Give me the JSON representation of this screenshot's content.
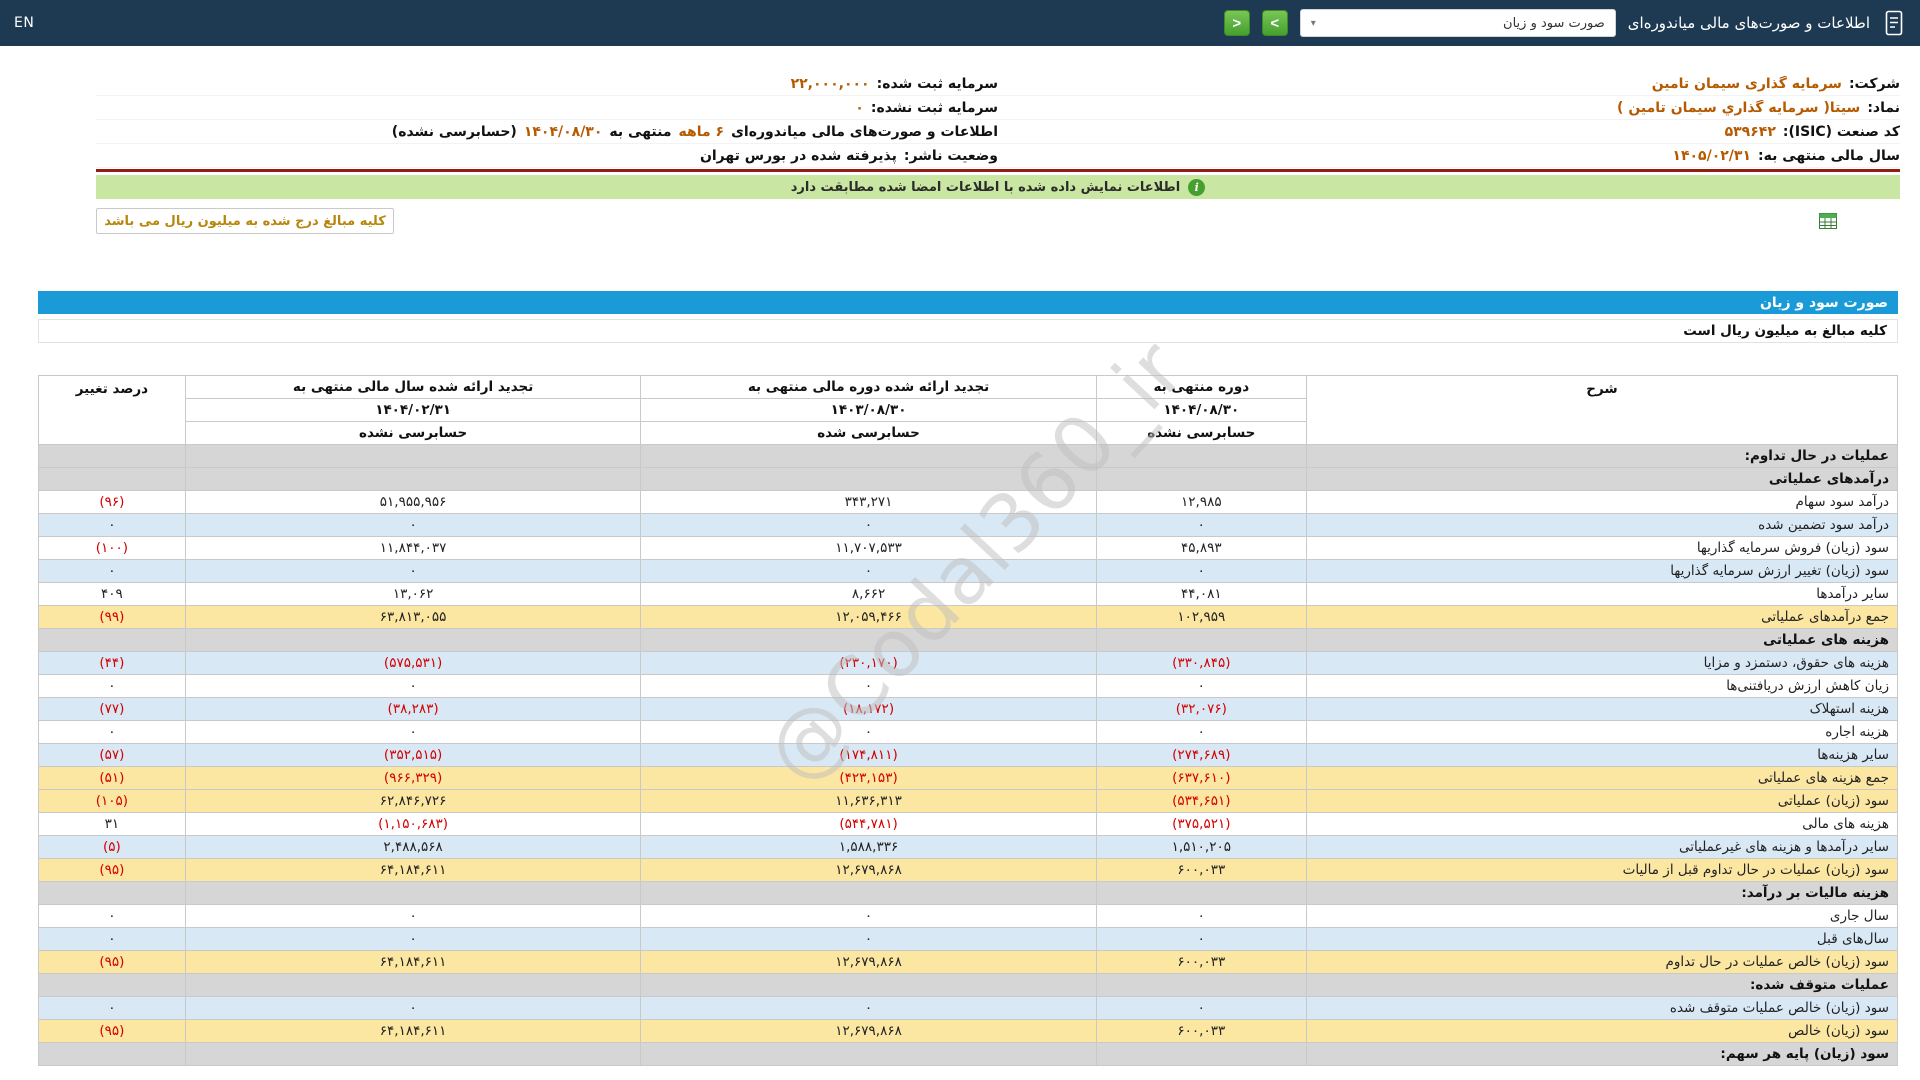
{
  "navbar": {
    "title": "اطلاعات و صورت‌های مالی میاندوره‌ای",
    "statement_select_value": "صورت سود و زیان",
    "select_caret": "▾",
    "next_button": ">",
    "prev_button": "<",
    "language": "EN"
  },
  "company_info": {
    "right_rows": [
      {
        "label": "شرکت:",
        "value": "سرمایه گذاری سیمان تامین"
      },
      {
        "label": "نماد:",
        "value": "سیتا( سرمایه گذاري سیمان تامین )"
      },
      {
        "label": "کد صنعت (ISIC):",
        "value": "۵۳۹۶۴۲"
      },
      {
        "label": "سال مالی منتهی به:",
        "value": "۱۴۰۵/۰۲/۳۱"
      }
    ],
    "left_rows": [
      {
        "label": "سرمایه ثبت شده:",
        "value": "۲۲,۰۰۰,۰۰۰",
        "value_style": "accent"
      },
      {
        "label": "سرمایه ثبت نشده:",
        "value": "۰",
        "value_style": "accent"
      },
      {
        "segments": [
          {
            "text": "اطلاعات و صورت‌های مالی میاندوره‌ای ",
            "style": "strong"
          },
          {
            "text": "۶ ماهه",
            "style": "accent"
          },
          {
            "text": " منتهی به ",
            "style": "strong"
          },
          {
            "text": "۱۴۰۴/۰۸/۳۰",
            "style": "accent"
          },
          {
            "text": "(حسابرسی نشده)",
            "style": "strong"
          }
        ]
      },
      {
        "label": "وضعیت ناشر:",
        "value": "پذیرفته شده در بورس تهران",
        "value_style": "strong"
      }
    ]
  },
  "signature_bar": {
    "text": "اطلاعات نمایش داده شده با اطلاعات امضا شده مطابقت دارد",
    "icon": "i"
  },
  "units_note": {
    "text": "کلیه مبالغ درج شده به میلیون ریال می باشد"
  },
  "statement": {
    "title": "صورت سود و زیان",
    "units_line": "کلیه مبالغ به میلیون ریال است",
    "watermark": "@Codal360_ir"
  },
  "table": {
    "headers": {
      "description": "شرح",
      "change": "درصد تغییر",
      "columns": [
        {
          "title": "دوره منتهی به",
          "date": "۱۴۰۴/۰۸/۳۰",
          "audit": "حسابرسی نشده"
        },
        {
          "title": "تجدید ارائه شده دوره مالی منتهی به",
          "date": "۱۴۰۳/۰۸/۳۰",
          "audit": "حسابرسی شده"
        },
        {
          "title": "تجدید ارائه شده سال مالی منتهی به",
          "date": "۱۴۰۴/۰۲/۳۱",
          "audit": "حسابرسی نشده"
        }
      ]
    },
    "rows": [
      {
        "type": "section",
        "label": "عملیات در حال تداوم:"
      },
      {
        "type": "section",
        "label": "درآمدهای عملیاتی"
      },
      {
        "type": "data",
        "shade": "white",
        "label": "درآمد سود سهام",
        "values": [
          "۱۲,۹۸۵",
          "۳۴۳,۲۷۱",
          "۵۱,۹۵۵,۹۵۶",
          "(۹۶)"
        ]
      },
      {
        "type": "data",
        "shade": "blue",
        "label": "درآمد سود تضمین شده",
        "values": [
          "۰",
          "۰",
          "۰",
          "۰"
        ]
      },
      {
        "type": "data",
        "shade": "white",
        "label": "سود (زیان) فروش سرمایه گذاریها",
        "values": [
          "۴۵,۸۹۳",
          "۱۱,۷۰۷,۵۳۳",
          "۱۱,۸۴۴,۰۳۷",
          "(۱۰۰)"
        ]
      },
      {
        "type": "data",
        "shade": "blue",
        "label": "سود (زیان) تغییر ارزش سرمایه گذاریها",
        "values": [
          "۰",
          "۰",
          "۰",
          "۰"
        ]
      },
      {
        "type": "data",
        "shade": "white",
        "label": "سایر درآمدها",
        "values": [
          "۴۴,۰۸۱",
          "۸,۶۶۲",
          "۱۳,۰۶۲",
          "۴۰۹"
        ]
      },
      {
        "type": "data",
        "shade": "yellow",
        "label": "جمع درآمدهای عملیاتی",
        "values": [
          "۱۰۲,۹۵۹",
          "۱۲,۰۵۹,۴۶۶",
          "۶۳,۸۱۳,۰۵۵",
          "(۹۹)"
        ]
      },
      {
        "type": "section",
        "label": "هزینه های عملیاتی"
      },
      {
        "type": "data",
        "shade": "blue",
        "label": "هزینه های حقوق، دستمزد و مزایا",
        "values": [
          "(۳۳۰,۸۴۵)",
          "(۲۳۰,۱۷۰)",
          "(۵۷۵,۵۳۱)",
          "(۴۴)"
        ]
      },
      {
        "type": "data",
        "shade": "white",
        "label": "زیان کاهش ارزش دریافتنی‌ها",
        "values": [
          "۰",
          "۰",
          "۰",
          "۰"
        ]
      },
      {
        "type": "data",
        "shade": "blue",
        "label": "هزینه استهلاک",
        "values": [
          "(۳۲,۰۷۶)",
          "(۱۸,۱۷۲)",
          "(۳۸,۲۸۳)",
          "(۷۷)"
        ]
      },
      {
        "type": "data",
        "shade": "white",
        "label": "هزینه اجاره",
        "values": [
          "۰",
          "۰",
          "۰",
          "۰"
        ]
      },
      {
        "type": "data",
        "shade": "blue",
        "label": "سایر هزینه‌ها",
        "values": [
          "(۲۷۴,۶۸۹)",
          "(۱۷۴,۸۱۱)",
          "(۳۵۲,۵۱۵)",
          "(۵۷)"
        ]
      },
      {
        "type": "data",
        "shade": "yellow",
        "label": "جمع هزینه های عملیاتی",
        "values": [
          "(۶۳۷,۶۱۰)",
          "(۴۲۳,۱۵۳)",
          "(۹۶۶,۳۲۹)",
          "(۵۱)"
        ]
      },
      {
        "type": "data",
        "shade": "yellow",
        "label": "سود (زیان) عملیاتی",
        "values": [
          "(۵۳۴,۶۵۱)",
          "۱۱,۶۳۶,۳۱۳",
          "۶۲,۸۴۶,۷۲۶",
          "(۱۰۵)"
        ]
      },
      {
        "type": "data",
        "shade": "white",
        "label": "هزینه های مالی",
        "values": [
          "(۳۷۵,۵۲۱)",
          "(۵۴۴,۷۸۱)",
          "(۱,۱۵۰,۶۸۳)",
          "۳۱"
        ]
      },
      {
        "type": "data",
        "shade": "blue",
        "label": "سایر درآمدها و هزینه های غیرعملیاتی",
        "values": [
          "۱,۵۱۰,۲۰۵",
          "۱,۵۸۸,۳۳۶",
          "۲,۴۸۸,۵۶۸",
          "(۵)"
        ]
      },
      {
        "type": "data",
        "shade": "yellow",
        "label": "سود (زیان) عملیات در حال تداوم قبل از مالیات",
        "values": [
          "۶۰۰,۰۳۳",
          "۱۲,۶۷۹,۸۶۸",
          "۶۴,۱۸۴,۶۱۱",
          "(۹۵)"
        ]
      },
      {
        "type": "section",
        "label": "هزینه مالیات بر درآمد:"
      },
      {
        "type": "data",
        "shade": "white",
        "label": "سال جاری",
        "values": [
          "۰",
          "۰",
          "۰",
          "۰"
        ]
      },
      {
        "type": "data",
        "shade": "blue",
        "label": "سال‌های قبل",
        "values": [
          "۰",
          "۰",
          "۰",
          "۰"
        ]
      },
      {
        "type": "data",
        "shade": "yellow",
        "label": "سود (زیان) خالص عملیات در حال تداوم",
        "values": [
          "۶۰۰,۰۳۳",
          "۱۲,۶۷۹,۸۶۸",
          "۶۴,۱۸۴,۶۱۱",
          "(۹۵)"
        ]
      },
      {
        "type": "section",
        "label": "عملیات متوقف شده:"
      },
      {
        "type": "data",
        "shade": "blue",
        "label": "سود (زیان) خالص عملیات متوقف شده",
        "values": [
          "۰",
          "۰",
          "۰",
          "۰"
        ]
      },
      {
        "type": "data",
        "shade": "yellow",
        "label": "سود (زیان) خالص",
        "values": [
          "۶۰۰,۰۳۳",
          "۱۲,۶۷۹,۸۶۸",
          "۶۴,۱۸۴,۶۱۱",
          "(۹۵)"
        ]
      },
      {
        "type": "section",
        "label": "سود (زیان) پایه هر سهم:"
      }
    ]
  },
  "colors": {
    "navbar_bg": "#1d3a52",
    "accent_text": "#b55a00",
    "negative_text": "#d40000",
    "statement_bar_bg": "#1a9bd7",
    "signature_bar_bg": "#c9e6a3",
    "green_button": "#46a02e",
    "row_blue": "#d9e8f5",
    "row_yellow": "#fbe6a2",
    "row_section": "#d6d6d6",
    "divider_red": "#8e1f12"
  }
}
